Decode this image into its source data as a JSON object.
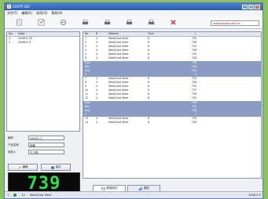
{
  "window": {
    "title": "CASTP 300"
  },
  "menu": [
    "文件(F)",
    "编辑(E)",
    "选项(O)",
    "帮助(H)"
  ],
  "toolbar": {
    "buttons": [
      {
        "name": "new-icon"
      },
      {
        "name": "save-icon"
      },
      {
        "name": "open-icon"
      },
      {
        "name": "print-icon"
      },
      {
        "name": "print-preview-icon"
      },
      {
        "name": "print-setup-icon"
      },
      {
        "name": "print-report-icon"
      },
      {
        "name": "delete-icon"
      }
    ],
    "url": "www.xiaoqu.com.cn"
  },
  "records": {
    "headers": {
      "no": "No.",
      "date": "Date"
    },
    "rows": [
      {
        "no": "1",
        "date": "2008-9-25"
      },
      {
        "no": "2",
        "date": "2008-9-5"
      }
    ]
  },
  "form": {
    "fields": [
      {
        "label": "编号",
        "value": "DX082-1"
      },
      {
        "label": "产品名称",
        "value": "轴套"
      },
      {
        "label": "检验人",
        "value": "王王刚"
      }
    ],
    "buttons": {
      "edit": "编辑",
      "save": "保存"
    }
  },
  "display": {
    "value": "739"
  },
  "grid": {
    "headers": {
      "no": "No.",
      "n": "N",
      "mat": "Material",
      "tol": "Tmin",
      "l": "L"
    },
    "rows": [
      {
        "hl": false,
        "no": "1",
        "n": "4",
        "mat": "Steel/Cast Steel",
        "tol": "8",
        "l": "735"
      },
      {
        "hl": false,
        "no": "2",
        "n": "4",
        "mat": "Steel/Cast Steel",
        "tol": "8",
        "l": "738"
      },
      {
        "hl": false,
        "no": "3",
        "n": "4",
        "mat": "Steel/Cast Steel",
        "tol": "8",
        "l": "729"
      },
      {
        "hl": false,
        "no": "4",
        "n": "4",
        "mat": "Steel/Cast Steel",
        "tol": "8",
        "l": "738"
      },
      {
        "hl": false,
        "no": "5",
        "n": "4",
        "mat": "Steel/Cast Steel",
        "tol": "8",
        "l": "735"
      },
      {
        "hl": false,
        "no": "6",
        "n": "4",
        "mat": "Steel/Cast Steel",
        "tol": "8",
        "l": "728"
      },
      {
        "hl": true,
        "no": "Max",
        "n": "",
        "mat": "",
        "tol": "",
        "l": "738"
      },
      {
        "hl": true,
        "no": "Min",
        "n": "",
        "mat": "",
        "tol": "",
        "l": "728"
      },
      {
        "hl": true,
        "no": "Avg",
        "n": "",
        "mat": "",
        "tol": "",
        "l": "734"
      },
      {
        "hl": true,
        "no": "S",
        "n": "",
        "mat": "",
        "tol": "",
        "l": "4"
      },
      {
        "hl": false,
        "no": "7",
        "n": "4",
        "mat": "Steel/Cast Steel",
        "tol": "8",
        "l": "735"
      },
      {
        "hl": false,
        "no": "8",
        "n": "4",
        "mat": "Steel/Cast Steel",
        "tol": "8",
        "l": "736"
      },
      {
        "hl": false,
        "no": "9",
        "n": "4",
        "mat": "Steel/Cast Steel",
        "tol": "8",
        "l": "732"
      },
      {
        "hl": false,
        "no": "10",
        "n": "4",
        "mat": "Steel/Cast Steel",
        "tol": "8",
        "l": "737"
      },
      {
        "hl": false,
        "no": "11",
        "n": "4",
        "mat": "Steel/Cast Steel",
        "tol": "8",
        "l": "739"
      },
      {
        "hl": false,
        "no": "12",
        "n": "4",
        "mat": "Steel/Cast Steel",
        "tol": "8",
        "l": "735"
      },
      {
        "hl": true,
        "no": "Max",
        "n": "",
        "mat": "",
        "tol": "",
        "l": "739"
      },
      {
        "hl": true,
        "no": "Min",
        "n": "",
        "mat": "",
        "tol": "",
        "l": "732"
      },
      {
        "hl": true,
        "no": "Avg",
        "n": "",
        "mat": "",
        "tol": "",
        "l": "736"
      },
      {
        "hl": true,
        "no": "S",
        "n": "",
        "mat": "",
        "tol": "",
        "l": "2"
      },
      {
        "hl": false,
        "no": "13",
        "n": "4",
        "mat": "Steel/Cast Steel",
        "tol": "8",
        "l": "739"
      },
      {
        "hl": false,
        "no": "14",
        "n": "4",
        "mat": "Steel/Cast Steel",
        "tol": "8",
        "l": "739"
      }
    ]
  },
  "tabs": [
    "数据测试",
    "图形"
  ],
  "status": {
    "items": [
      "1",
      "14",
      "Steel/Cast Steel"
    ],
    "right": [
      "2008-9-5"
    ]
  }
}
